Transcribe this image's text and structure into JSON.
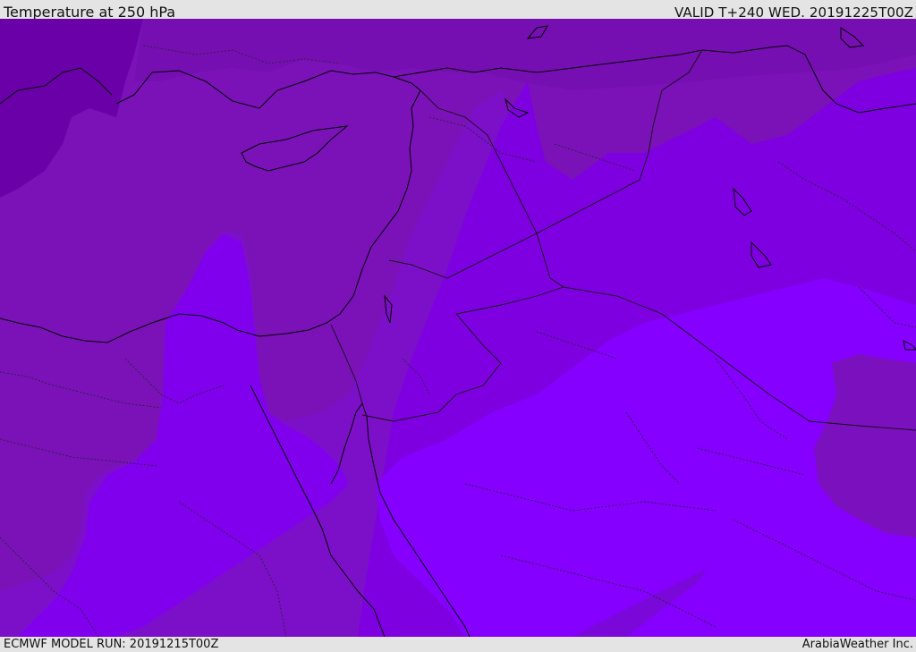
{
  "header": {
    "title": "Temperature at 250 hPa",
    "valid_time": "VALID T+240 WED. 20191225T00Z"
  },
  "footer": {
    "model_run": "ECMWF MODEL RUN: 20191215T00Z",
    "credit": "ArabiaWeather Inc."
  },
  "map": {
    "field": "temperature",
    "level": "250 hPa",
    "colors": {
      "coldest": "#6a00a8",
      "cold": "#7a12b8",
      "mid": "#7e00e0",
      "warm": "#8500ff",
      "coastline": "#000000",
      "borders": "#1a1a1a"
    },
    "features": [
      "coastlines",
      "country borders",
      "province borders"
    ]
  }
}
